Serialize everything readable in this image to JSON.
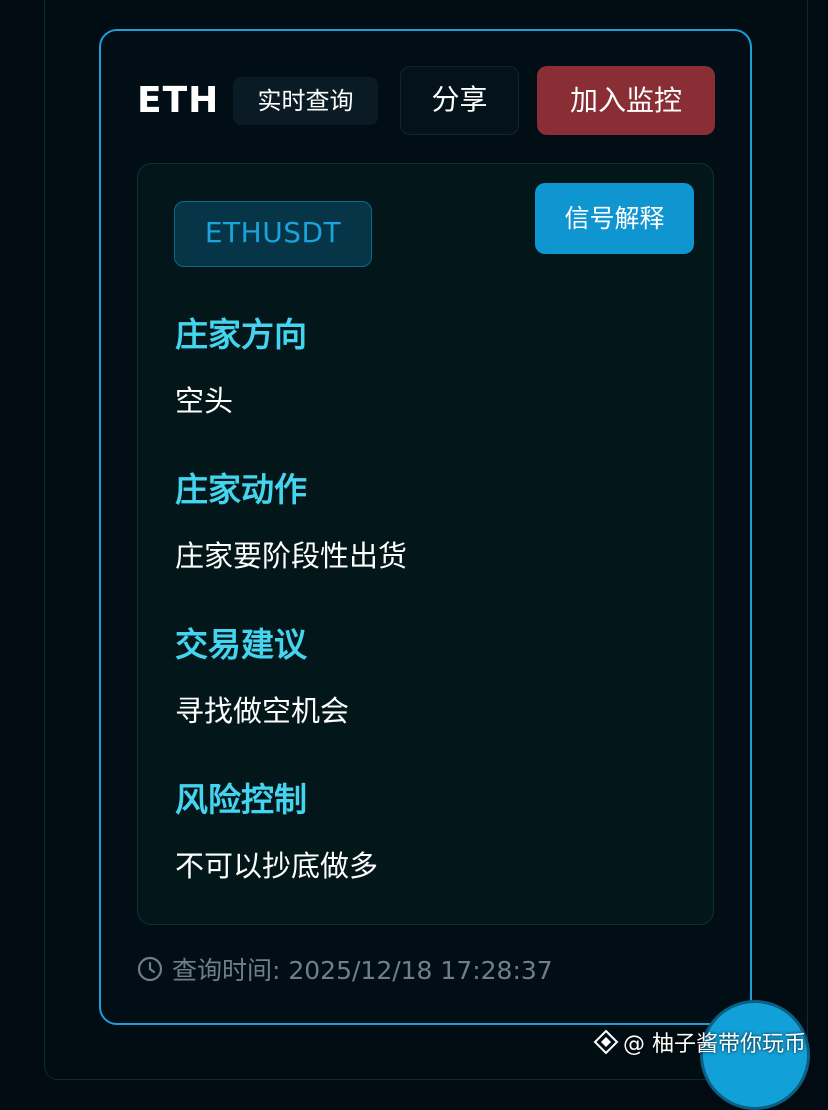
{
  "header": {
    "coin": "ETH",
    "realtime_label": "实时查询",
    "share_label": "分享",
    "monitor_label": "加入监控"
  },
  "panel": {
    "symbol": "ETHUSDT",
    "explain_label": "信号解释",
    "sections": [
      {
        "title": "庄家方向",
        "value": "空头"
      },
      {
        "title": "庄家动作",
        "value": "庄家要阶段性出货"
      },
      {
        "title": "交易建议",
        "value": "寻找做空机会"
      },
      {
        "title": "风险控制",
        "value": "不可以抄底做多"
      }
    ]
  },
  "footer": {
    "query_time": "查询时间: 2025/12/18 17:28:37"
  },
  "watermark": {
    "text": "@ 柚子酱带你玩币"
  },
  "colors": {
    "accent_border": "#1a9fd8",
    "section_title": "#45d4ef",
    "monitor_button": "#8a2e36",
    "explain_button": "#0f95cf"
  },
  "icons": {
    "time": "clock-icon",
    "watermark": "diamond-icon"
  }
}
